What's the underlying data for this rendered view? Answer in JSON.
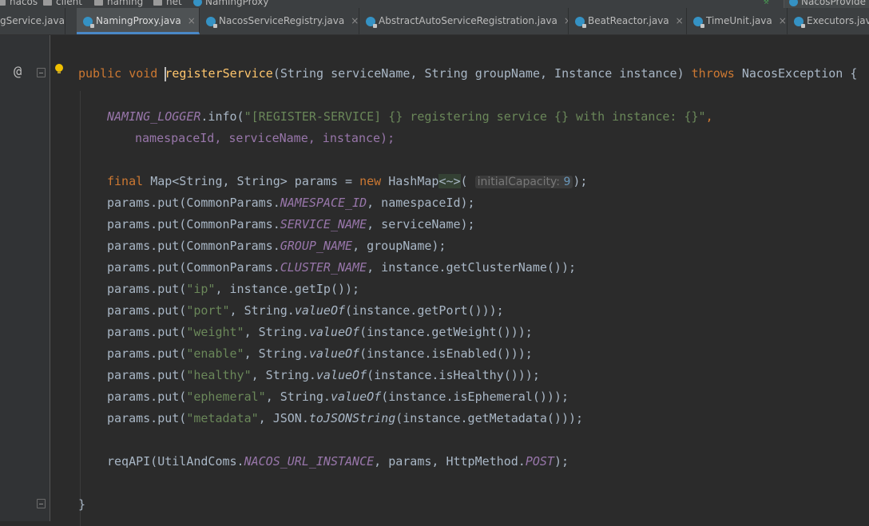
{
  "breadcrumb": {
    "items": [
      "nacos",
      "client",
      "naming",
      "net",
      "NamingProxy"
    ],
    "right_label": "NacosProvide"
  },
  "tabs": [
    {
      "label": "gService.java",
      "active": false
    },
    {
      "label": "NamingProxy.java",
      "active": true
    },
    {
      "label": "NacosServiceRegistry.java",
      "active": false
    },
    {
      "label": "AbstractAutoServiceRegistration.java",
      "active": false
    },
    {
      "label": "BeatReactor.java",
      "active": false
    },
    {
      "label": "TimeUnit.java",
      "active": false
    },
    {
      "label": "Executors.jav",
      "active": false
    }
  ],
  "gutter": {
    "at_symbol": "@"
  },
  "code": {
    "sig_public": "public",
    "sig_void": "void",
    "sig_name": "registerService",
    "sig_params": "(String serviceName, String groupName, Instance instance)",
    "sig_throws": "throws",
    "sig_exc": "NacosException {",
    "log_obj": "NAMING_LOGGER",
    "log_call": ".info(",
    "log_str": "\"[REGISTER-SERVICE] {} registering service {} with instance: {}\"",
    "log_args": "namespaceId, serviceName, instance);",
    "map_final": "final",
    "map_decl": "Map<String, String> params = ",
    "map_new": "new",
    "map_type": "HashMap",
    "map_diamond": "<~>",
    "map_hint_label": "initialCapacity:",
    "map_hint_value": "9",
    "map_end": ");",
    "puts": [
      {
        "pre": "params.put(CommonParams.",
        "const": "NAMESPACE_ID",
        "post": ", namespaceId);"
      },
      {
        "pre": "params.put(CommonParams.",
        "const": "SERVICE_NAME",
        "post": ", serviceName);"
      },
      {
        "pre": "params.put(CommonParams.",
        "const": "GROUP_NAME",
        "post": ", groupName);"
      },
      {
        "pre": "params.put(CommonParams.",
        "const": "CLUSTER_NAME",
        "post": ", instance.getClusterName());"
      }
    ],
    "str_puts": [
      {
        "key": "\"ip\"",
        "rest": ", instance.getIp());",
        "stat": ""
      },
      {
        "key": "\"port\"",
        "rest_pre": ", String.",
        "stat": "valueOf",
        "rest": "(instance.getPort()));"
      },
      {
        "key": "\"weight\"",
        "rest_pre": ", String.",
        "stat": "valueOf",
        "rest": "(instance.getWeight()));"
      },
      {
        "key": "\"enable\"",
        "rest_pre": ", String.",
        "stat": "valueOf",
        "rest": "(instance.isEnabled()));"
      },
      {
        "key": "\"healthy\"",
        "rest_pre": ", String.",
        "stat": "valueOf",
        "rest": "(instance.isHealthy()));"
      },
      {
        "key": "\"ephemeral\"",
        "rest_pre": ", String.",
        "stat": "valueOf",
        "rest": "(instance.isEphemeral()));"
      },
      {
        "key": "\"metadata\"",
        "rest_pre": ", JSON.",
        "stat": "toJSONString",
        "rest": "(instance.getMetadata()));"
      }
    ],
    "req_pre": "reqAPI(UtilAndComs.",
    "req_const": "NACOS_URL_INSTANCE",
    "req_mid": ", params, HttpMethod.",
    "req_const2": "POST",
    "req_end": ");",
    "close_brace": "}"
  }
}
